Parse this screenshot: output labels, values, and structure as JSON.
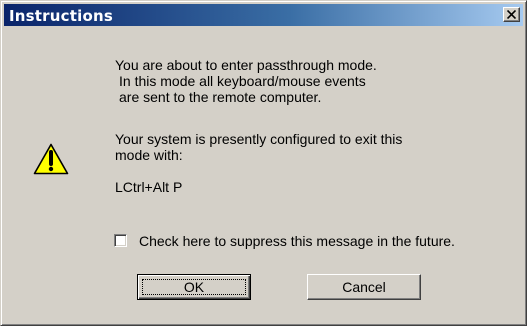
{
  "window": {
    "title": "Instructions",
    "close_label": "close"
  },
  "message": {
    "line1": "You are about to enter passthrough mode.",
    "line2": "In this mode all keyboard/mouse events",
    "line3": "are sent to the remote computer.",
    "line4": "Your system is presently configured to exit this",
    "line5": "mode with:",
    "hotkey": "LCtrl+Alt P"
  },
  "checkbox": {
    "label": "Check here to suppress this message in the future.",
    "checked": false
  },
  "buttons": {
    "ok": "OK",
    "cancel": "Cancel"
  },
  "icons": {
    "warning": "warning-icon",
    "close": "close-icon"
  },
  "colors": {
    "titlebar_start": "#0a246a",
    "titlebar_end": "#a6caf0",
    "dialog_bg": "#d4d0c8",
    "warning_yellow": "#ffff00"
  }
}
